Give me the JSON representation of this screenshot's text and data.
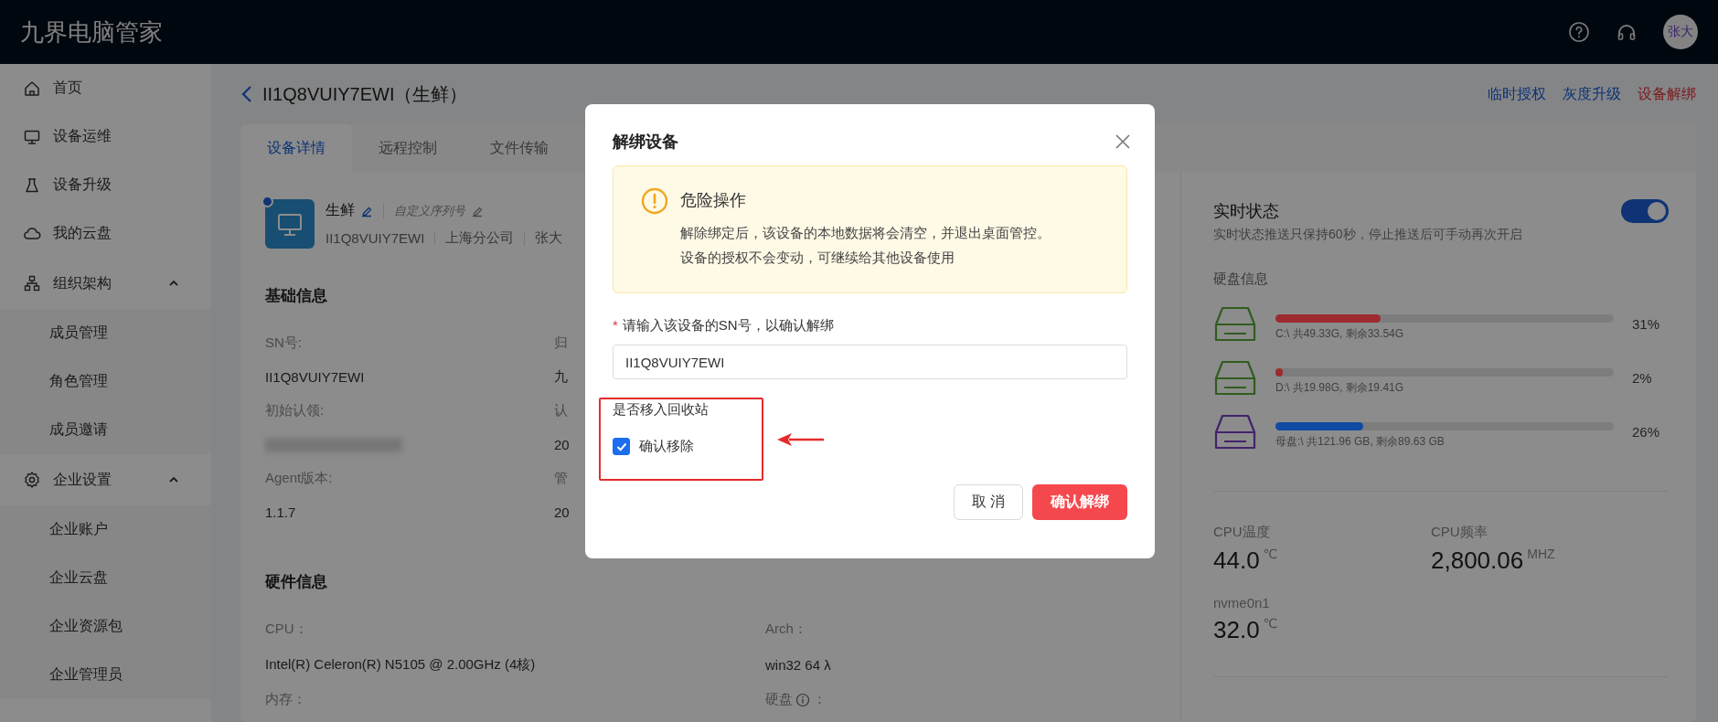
{
  "app": {
    "title": "九界电脑管家",
    "avatar": "张大"
  },
  "sidebar": {
    "items": [
      {
        "label": "首页"
      },
      {
        "label": "设备运维"
      },
      {
        "label": "设备升级"
      },
      {
        "label": "我的云盘"
      },
      {
        "label": "组织架构",
        "expanded": true,
        "children": [
          {
            "label": "成员管理"
          },
          {
            "label": "角色管理"
          },
          {
            "label": "成员邀请"
          }
        ]
      },
      {
        "label": "企业设置",
        "expanded": true,
        "children": [
          {
            "label": "企业账户"
          },
          {
            "label": "企业云盘"
          },
          {
            "label": "企业资源包"
          },
          {
            "label": "企业管理员"
          }
        ]
      }
    ]
  },
  "page": {
    "title": "II1Q8VUIY7EWI（生鲜）",
    "actions": [
      {
        "label": "临时授权",
        "kind": "link"
      },
      {
        "label": "灰度升级",
        "kind": "link"
      },
      {
        "label": "设备解绑",
        "kind": "danger"
      }
    ]
  },
  "tabs": [
    {
      "label": "设备详情",
      "selected": true
    },
    {
      "label": "远程控制",
      "selected": false
    },
    {
      "label": "文件传输",
      "selected": false
    }
  ],
  "device": {
    "name": "生鲜",
    "serial_hint": "自定义序列号",
    "meta": [
      "II1Q8VUIY7EWI",
      "上海分公司",
      "张大"
    ]
  },
  "basic_info": {
    "title": "基础信息",
    "fields": [
      {
        "label": "SN号:",
        "value": "II1Q8VUIY7EWI",
        "label_2": "归",
        "value_2": "九"
      },
      {
        "label": "初始认领:",
        "redacted": true,
        "label_2": "认",
        "value_2": "20"
      },
      {
        "label": "Agent版本:",
        "value": "1.1.7",
        "label_2": "管",
        "value_2": "20"
      }
    ]
  },
  "hardware": {
    "title": "硬件信息",
    "fields": [
      {
        "label": "CPU：",
        "value": "Intel(R) Celeron(R) N5105 @ 2.00GHz (4核)"
      },
      {
        "label": "Arch：",
        "value": "win32 64 λ"
      },
      {
        "label": "内存："
      },
      {
        "label": "硬盘",
        "info": true,
        "suffix": "："
      }
    ]
  },
  "status": {
    "title": "实时状态",
    "on": true,
    "subtitle": "实时状态推送只保持60秒，停止推送后可手动再次开启",
    "disk_title": "硬盘信息",
    "disks": [
      {
        "kind": "partition",
        "level": 0.31,
        "percent": "31%",
        "color": "#9c2b30",
        "label": "C:\\ 共49.33G, 剩余33.54G"
      },
      {
        "kind": "partition",
        "level": 0.02,
        "percent": "2%",
        "color": "#9c2b30",
        "label": "D:\\ 共19.98G, 剩余19.41G"
      },
      {
        "kind": "master",
        "level": 0.26,
        "percent": "26%",
        "color": "#0f4aa3",
        "label": "母盘:\\ 共121.96 GB, 剩余89.63 GB"
      }
    ],
    "metrics": [
      {
        "label": "CPU温度",
        "value": "44.0",
        "unit": "℃"
      },
      {
        "label": "CPU频率",
        "value": "2,800.06",
        "unit": "MHZ"
      },
      {
        "label": "nvme0n1",
        "value": "32.0",
        "unit": "℃"
      }
    ]
  },
  "modal": {
    "title": "解绑设备",
    "alert": {
      "title": "危险操作",
      "lines": [
        "解除绑定后，该设备的本地数据将会清空，并退出桌面管控。",
        "设备的授权不会变动，可继续给其他设备使用"
      ]
    },
    "field": {
      "required_mark": "*",
      "label": "请输入该设备的SN号，以确认解绑",
      "value": "II1Q8VUIY7EWI"
    },
    "recycle": {
      "label": "是否移入回收站",
      "option": "确认移除",
      "checked": true
    },
    "buttons": [
      {
        "label": "取 消",
        "kind": "default"
      },
      {
        "label": "确认解绑",
        "kind": "danger"
      }
    ]
  }
}
